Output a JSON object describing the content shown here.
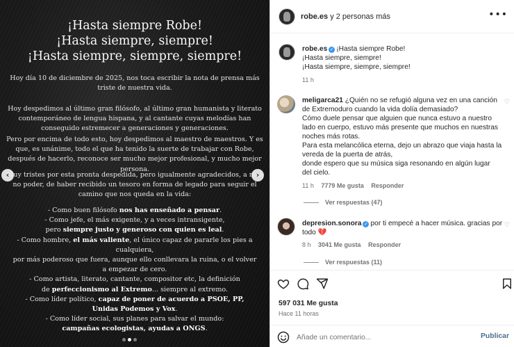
{
  "image": {
    "title_lines": [
      "¡Hasta siempre Robe!",
      "¡Hasta siempre, siempre!",
      "¡Hasta siempre, siempre, siempre!"
    ],
    "p1": "Hoy día 10 de diciembre de 2025, nos toca escribir la nota de prensa más triste de nuestra vida.",
    "p2": "Hoy despedimos al último gran filósofo, al último gran humanista y literato contemporáneo de lengua hispana, y al cantante cuyas melodías han conseguido estremecer a generaciones y generaciones.",
    "p3": "Pero por encima de todo esto, hoy despedimos al maestro de maestros. Y es que, es unánime, todo el que ha tenido la suerte de trabajar con Robe, después de hacerlo, reconoce ser mucho mejor profesional, y mucho mejor persona.",
    "p4": "Muy tristes por esta pronta despedida, pero igualmente agradecidos, a más no poder, de haber recibido un tesoro en forma de legado para seguir el camino que nos queda en la vida:",
    "list": [
      {
        "pre": "- Como buen filósofo ",
        "bold": "nos has enseñado a pensar",
        "post": "."
      },
      {
        "pre": "- Como jefe, el más exigente, y a veces intransigente,",
        "bold": "",
        "post": ""
      },
      {
        "pre": "pero ",
        "bold": "siempre justo y generoso con quien es leal",
        "post": "."
      },
      {
        "pre": "- Como hombre, ",
        "bold": "el más valiente",
        "post": ", el único capaz de pararle los pies a cualquiera,"
      },
      {
        "pre": "por más poderoso que fuera, aunque ello conllevara la ruina, o el volver",
        "bold": "",
        "post": ""
      },
      {
        "pre": "a empezar de cero.",
        "bold": "",
        "post": ""
      },
      {
        "pre": "- Como artista, literato, cantante, compositor etc, la definición",
        "bold": "",
        "post": ""
      },
      {
        "pre": "de ",
        "bold": "perfeccionismo al Extremo",
        "post": "... siempre al extremo."
      },
      {
        "pre": "- Como líder político, ",
        "bold": "capaz de poner de acuerdo a PSOE, PP,",
        "post": ""
      },
      {
        "pre": "",
        "bold": "Unidas Podemos y Vox",
        "post": "."
      },
      {
        "pre": "- Como líder social, sus planes para salvar el mundo:",
        "bold": "",
        "post": ""
      },
      {
        "pre": "",
        "bold": "campañas ecologistas, ayudas a ONGS",
        "post": "."
      }
    ],
    "prev_symbol": "‹",
    "next_symbol": "›"
  },
  "header": {
    "username": "robe.es",
    "suffix": " y 2 personas más",
    "more_symbol": "•••"
  },
  "caption": {
    "username": "robe.es",
    "line1": "¡Hasta siempre Robe!",
    "line2": "¡Hasta siempre, siempre!",
    "line3": "¡Hasta siempre, siempre, siempre!",
    "time": "11 h"
  },
  "comments": [
    {
      "username": "meligarca21",
      "lines": [
        "¿Quién no se refugió alguna vez en una canción",
        "de Extremoduro cuando la vida dolía demasiado?",
        "Cómo duele pensar que alguien que nunca estuvo a nuestro",
        "lado en cuerpo, estuvo más presente que muchos en nuestras",
        "noches más rotas.",
        "Para esta melancólica eterna, dejo un abrazo que viaja hasta la",
        "vereda de la puerta de atrás,",
        "donde espero que su música siga resonando en algún lugar",
        "del cielo."
      ],
      "time": "11 h",
      "likes": "7779 Me gusta",
      "reply": "Responder",
      "view_replies": "Ver respuestas (47)"
    },
    {
      "username": "depresion.sonora",
      "line1": "por ti empecé a hacer música. gracias por",
      "line2": "todo 💔",
      "time": "8 h",
      "likes": "3041 Me gusta",
      "reply": "Responder",
      "view_replies": "Ver respuestas (11)"
    }
  ],
  "stats": {
    "likes": "597 031 Me gusta",
    "time_ago": "Hace 11 horas"
  },
  "compose": {
    "placeholder": "Añade un comentario...",
    "post_label": "Publicar"
  },
  "colors": {
    "verified": "#3897f0",
    "heart_emoji": "#e0245e"
  },
  "icons": [
    "heart-icon",
    "comment-icon",
    "share-icon",
    "bookmark-icon",
    "emoji-icon",
    "more-options-icon",
    "verified-badge-icon"
  ]
}
